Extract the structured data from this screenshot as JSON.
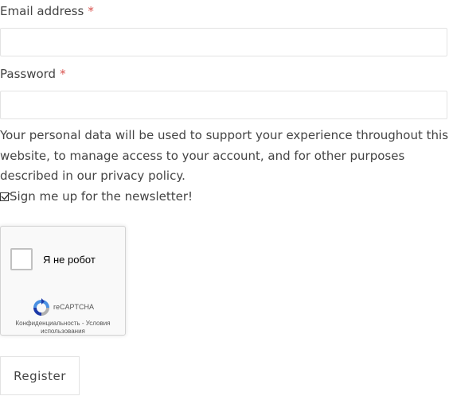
{
  "form": {
    "email_label": "Email address",
    "password_label": "Password",
    "required_mark": "*",
    "email_value": "",
    "password_value": "",
    "privacy_text_before": "Your personal data will be used to support your experience throughout this website, to manage access to your account, and for other purposes described in our ",
    "privacy_link": "privacy policy",
    "privacy_text_after": ".",
    "newsletter_label": "Sign me up for the newsletter!",
    "newsletter_checked": true,
    "register_label": "Register"
  },
  "captcha": {
    "checkbox_label": "Я не робот",
    "brand": "reCAPTCHA",
    "privacy_link": "Конфиденциальность",
    "separator": " - ",
    "terms_link": "Условия использования",
    "icon": "recaptcha-logo-icon"
  },
  "colors": {
    "required": "#d9534f",
    "text": "#444444",
    "field_border": "#e3e3e3"
  }
}
